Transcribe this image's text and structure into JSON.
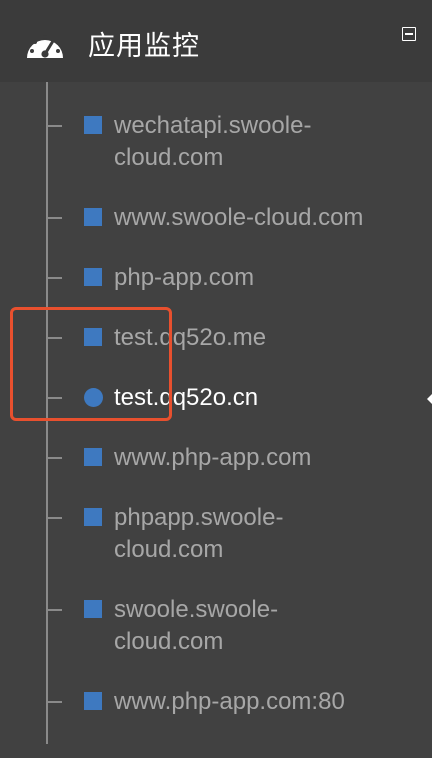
{
  "header": {
    "title": "应用监控",
    "icon": "dashboard-gauge-icon",
    "collapse_icon": "collapse-minus-icon"
  },
  "items": [
    {
      "line1": "wechatapi.swoole-",
      "line2": "cloud.com",
      "bullet": "square"
    },
    {
      "line1": "www.swoole-cloud.com",
      "line2": "",
      "bullet": "square"
    },
    {
      "line1": "php-app.com",
      "line2": "",
      "bullet": "square"
    },
    {
      "line1": "test.qq52o.me",
      "line2": "",
      "bullet": "square"
    },
    {
      "line1": "test.qq52o.cn",
      "line2": "",
      "bullet": "circle",
      "active": true
    },
    {
      "line1": "www.php-app.com",
      "line2": "",
      "bullet": "square"
    },
    {
      "line1": "phpapp.swoole-",
      "line2": "cloud.com",
      "bullet": "square"
    },
    {
      "line1": "swoole.swoole-",
      "line2": "cloud.com",
      "bullet": "square"
    },
    {
      "line1": "www.php-app.com:80",
      "line2": "",
      "bullet": "square"
    }
  ],
  "colors": {
    "background": "#414141",
    "header_background": "#3b3b3b",
    "bullet": "#3e79c0",
    "highlight": "#e8502e",
    "text": "#a7a7a7",
    "active_text": "#ffffff"
  }
}
